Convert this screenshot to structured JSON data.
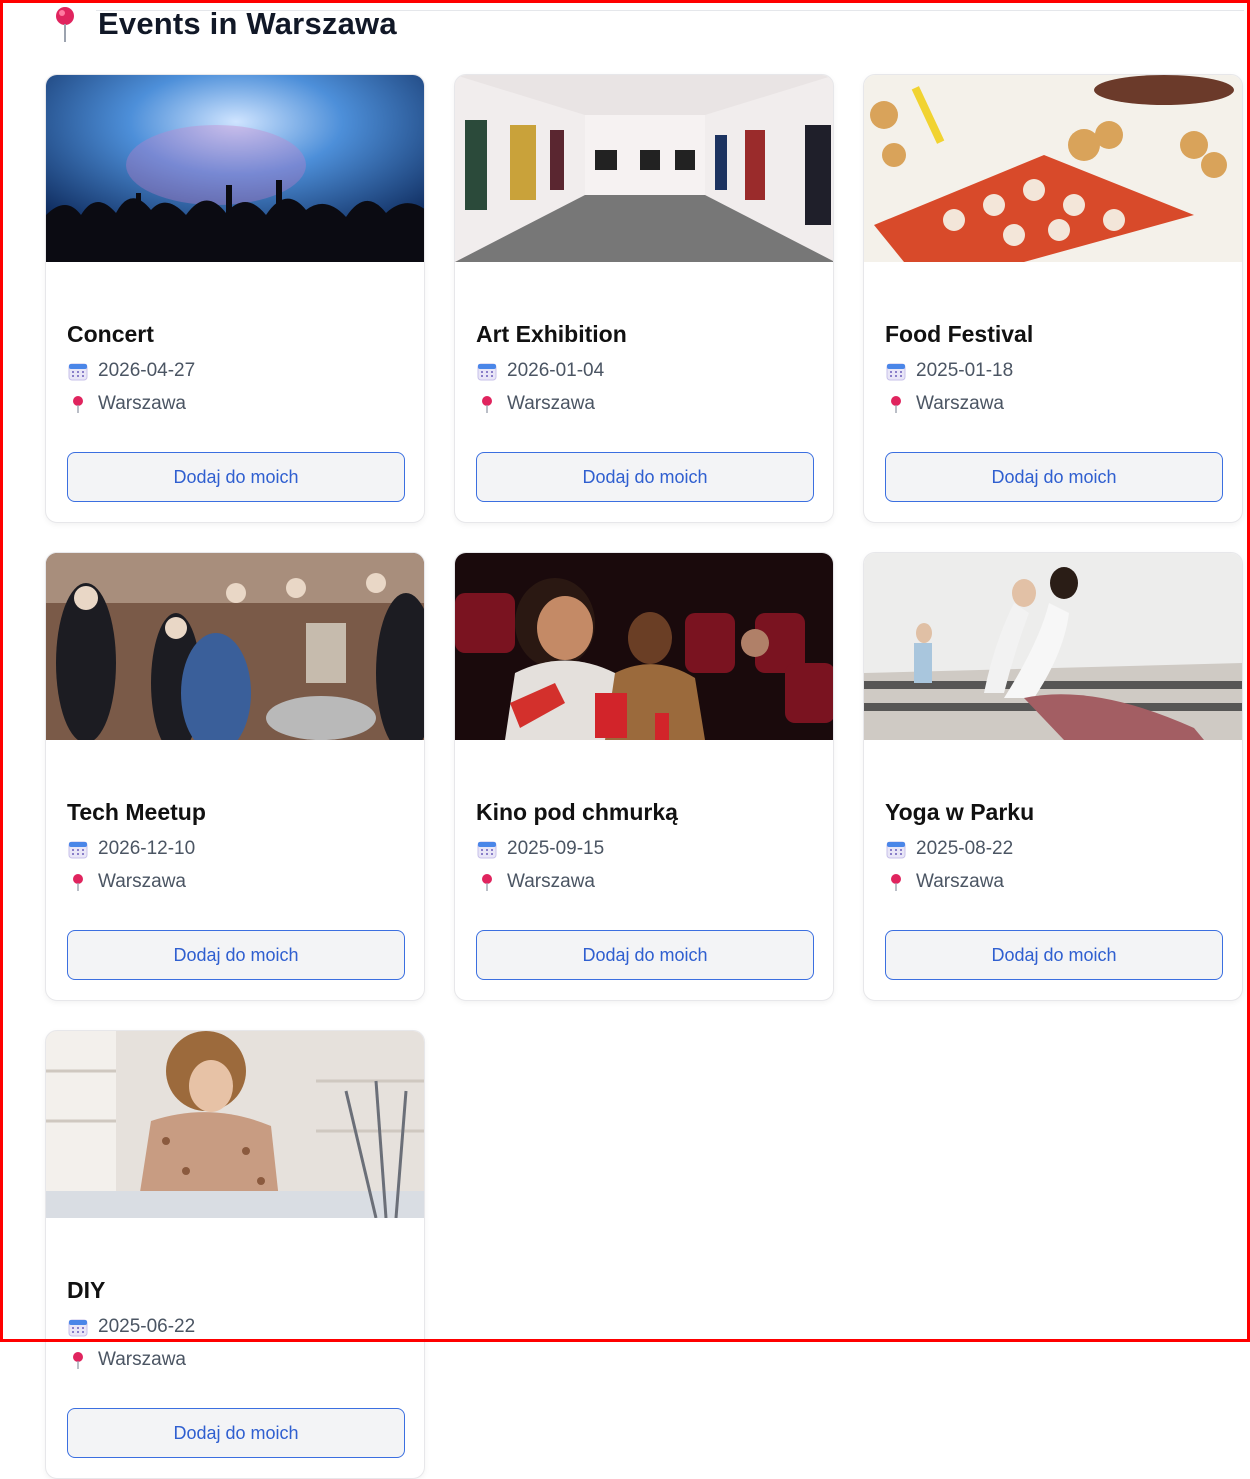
{
  "page": {
    "title": "Events in Warszawa",
    "title_icon": "map-pin-icon"
  },
  "colors": {
    "accent": "#2f5fd0",
    "button_border": "#3b6fe0",
    "pin": "#e0245e",
    "frame": "#ff0000"
  },
  "events": [
    {
      "title": "Concert",
      "date": "2026-04-27",
      "location": "Warszawa",
      "button": "Dodaj do moich",
      "image": "concert-crowd-image"
    },
    {
      "title": "Art Exhibition",
      "date": "2026-01-04",
      "location": "Warszawa",
      "button": "Dodaj do moich",
      "image": "art-gallery-image"
    },
    {
      "title": "Food Festival",
      "date": "2025-01-18",
      "location": "Warszawa",
      "button": "Dodaj do moich",
      "image": "food-platter-image"
    },
    {
      "title": "Tech Meetup",
      "date": "2026-12-10",
      "location": "Warszawa",
      "button": "Dodaj do moich",
      "image": "meetup-crowd-image"
    },
    {
      "title": "Kino pod chmurką",
      "date": "2025-09-15",
      "location": "Warszawa",
      "button": "Dodaj do moich",
      "image": "cinema-audience-image"
    },
    {
      "title": "Yoga w Parku",
      "date": "2025-08-22",
      "location": "Warszawa",
      "button": "Dodaj do moich",
      "image": "yoga-class-image"
    },
    {
      "title": "DIY",
      "date": "2025-06-22",
      "location": "Warszawa",
      "button": "Dodaj do moich",
      "image": "crafting-workshop-image"
    }
  ]
}
